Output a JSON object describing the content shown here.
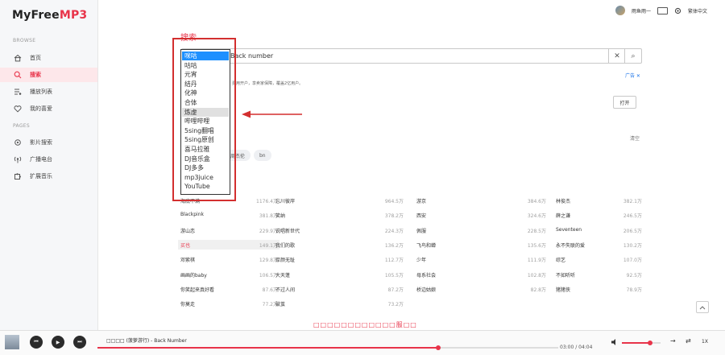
{
  "app": {
    "logo_main": "MyFree",
    "logo_accent": "MP3"
  },
  "sidebar": {
    "browse_head": "BROWSE",
    "pages_head": "PAGES",
    "browse": [
      {
        "name": "sidebar-item-home",
        "icon": "home-icon",
        "label": "首页",
        "active": false
      },
      {
        "name": "sidebar-item-search",
        "icon": "search-icon",
        "label": "搜索",
        "active": true
      },
      {
        "name": "sidebar-item-playlist",
        "icon": "playlist-icon",
        "label": "播放列表",
        "active": false
      },
      {
        "name": "sidebar-item-favorites",
        "icon": "heart-icon",
        "label": "我的喜爱",
        "active": false
      }
    ],
    "pages": [
      {
        "name": "sidebar-item-video-search",
        "icon": "gear-icon",
        "label": "影片搜索",
        "active": false
      },
      {
        "name": "sidebar-item-radio",
        "icon": "radio-icon",
        "label": "广播电台",
        "active": false
      },
      {
        "name": "sidebar-item-extension",
        "icon": "puzzle-icon",
        "label": "扩展音乐",
        "active": false
      }
    ]
  },
  "topbar": {
    "username": "雨鱼雨一",
    "language": "繁体中文"
  },
  "search": {
    "title": "搜索",
    "query": "Back number",
    "clear_glyph": "✕",
    "search_glyph": "⌕",
    "ad_text": "费用开户，享卖家保障，覆盖2亿用户。",
    "ad_tag": "广告 ✕",
    "open_label": "打开",
    "history_clear": "清空",
    "history_tags": [
      "周杰伦",
      "bn"
    ]
  },
  "source_dropdown": {
    "options": [
      "咪咕",
      "咕咕",
      "元宵",
      "结丹",
      "化神",
      "合体",
      "炼虚",
      "哔哩哔哩",
      "5sing翻唱",
      "5sing原创",
      "喜马拉雅",
      "DJ音乐盒",
      "DJ多多",
      "mp3juice",
      "YouTube"
    ],
    "selected_index": 0,
    "hover_index": 6
  },
  "ranking": {
    "columns": [
      [
        {
          "name": "海底不满",
          "count": "1176.4万"
        },
        {
          "name": "Blackpink",
          "count": "381.8万"
        },
        {
          "name": "游山恋",
          "count": "229.9万"
        },
        {
          "name": "买也",
          "count": "149.1万",
          "highlight": true
        },
        {
          "name": "邓紫棋",
          "count": "129.8万"
        },
        {
          "name": "画画的baby",
          "count": "106.5万"
        },
        {
          "name": "你笑起来真好看",
          "count": "87.6万"
        },
        {
          "name": "你莫走",
          "count": "77.2万"
        }
      ],
      [
        {
          "name": "忘川彼岸",
          "count": "964.5万"
        },
        {
          "name": "笑纳",
          "count": "378.2万"
        },
        {
          "name": "说唱新世代",
          "count": "224.3万"
        },
        {
          "name": "我们的歌",
          "count": "136.2万"
        },
        {
          "name": "厚颜无耻",
          "count": "112.7万"
        },
        {
          "name": "大天蓬",
          "count": "105.5万"
        },
        {
          "name": "不过人间",
          "count": "87.2万"
        },
        {
          "name": "破茧",
          "count": "73.2万"
        }
      ],
      [
        {
          "name": "游京",
          "count": "384.6万"
        },
        {
          "name": "西安",
          "count": "324.6万"
        },
        {
          "name": "佩服",
          "count": "228.5万"
        },
        {
          "name": "飞鸟和蝉",
          "count": "135.6万"
        },
        {
          "name": "少年",
          "count": "111.9万"
        },
        {
          "name": "母系社会",
          "count": "102.8万"
        },
        {
          "name": "桥边姑娘",
          "count": "82.8万"
        }
      ],
      [
        {
          "name": "林俊杰",
          "count": "382.1万"
        },
        {
          "name": "薛之谦",
          "count": "246.5万"
        },
        {
          "name": "Seventeen",
          "count": "206.5万"
        },
        {
          "name": "永不失联的爱",
          "count": "130.2万"
        },
        {
          "name": "综艺",
          "count": "107.0万"
        },
        {
          "name": "不如听听",
          "count": "92.5万"
        },
        {
          "name": "猪猪侠",
          "count": "78.9万"
        }
      ]
    ]
  },
  "marquee": "□□□□□□□□□□□□服□□",
  "player": {
    "title": "□□□□ (菠萝游行) - Back Number",
    "time": "03:00 / 04:04",
    "progress_fraction": 0.74,
    "volume_fraction": 0.72,
    "speed": "1X",
    "prev_glyph": "⏮",
    "play_glyph": "▶",
    "next_glyph": "⏭",
    "order_glyph": "→",
    "loop_glyph": "⇄"
  }
}
